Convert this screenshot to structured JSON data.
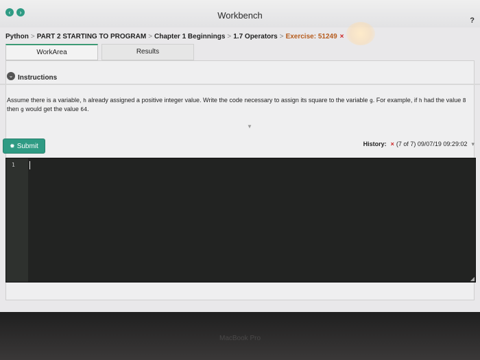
{
  "window": {
    "title": "Workbench",
    "help": "?"
  },
  "breadcrumb": {
    "items": [
      "Python",
      "PART 2 STARTING TO PROGRAM",
      "Chapter 1 Beginnings",
      "1.7 Operators",
      "Exercise: 51249"
    ],
    "separator": ">",
    "close_mark": "×"
  },
  "tabs": [
    {
      "label": "WorkArea",
      "active": true
    },
    {
      "label": "Results",
      "active": false
    }
  ],
  "instructions": {
    "heading": "Instructions",
    "text_parts": [
      "Assume there is a variable, ",
      "h",
      " already assigned a positive integer value. Write the code necessary to assign its square to the variable ",
      "g",
      ". For example, if ",
      "h",
      " had the value ",
      "8",
      " then ",
      "g",
      " would get the value ",
      "64",
      "."
    ]
  },
  "submit": {
    "label": "Submit",
    "icon": "gear-icon"
  },
  "history": {
    "label": "History:",
    "status_mark": "×",
    "count": "(7 of 7)",
    "timestamp": "09/07/19 09:29:02"
  },
  "editor": {
    "line_numbers": [
      "1"
    ]
  },
  "device": {
    "brand": "MacBook Pro"
  },
  "colors": {
    "accent": "#2f9b84",
    "error": "#cc2222",
    "exercise": "#b65c1d",
    "editor_bg": "#222322"
  }
}
